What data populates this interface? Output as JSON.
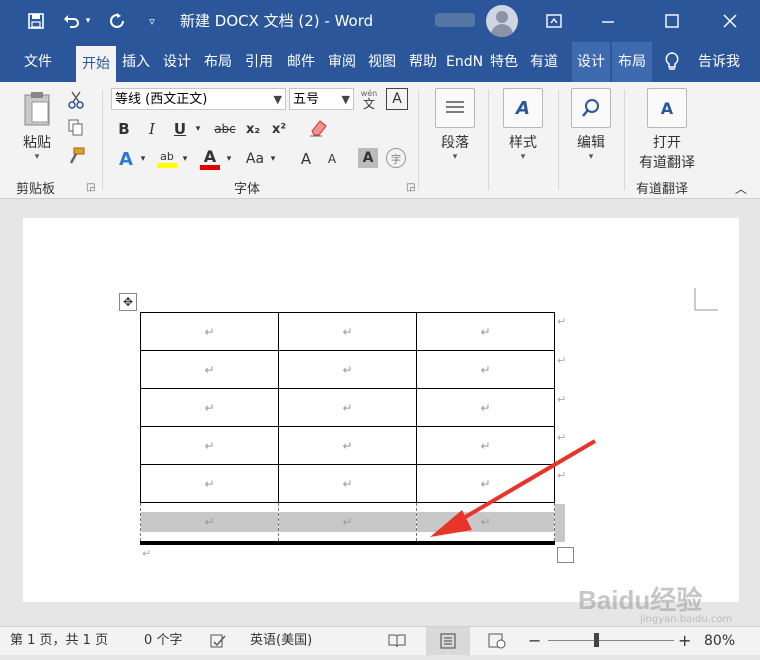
{
  "window": {
    "title": "新建 DOCX 文档 (2)  -  Word"
  },
  "quick_access": {
    "save_icon": "save-icon",
    "undo_icon": "undo-icon",
    "redo_icon": "redo-icon"
  },
  "tabs": [
    "文件",
    "开始",
    "插入",
    "设计",
    "布局",
    "引用",
    "邮件",
    "审阅",
    "视图",
    "帮助",
    "EndN",
    "特色",
    "有道",
    "设计",
    "布局"
  ],
  "tell_me": "告诉我",
  "ribbon": {
    "clipboard": {
      "paste": "粘贴",
      "label": "剪贴板"
    },
    "font": {
      "name": "等线 (西文正文)",
      "size": "五号",
      "label": "字体",
      "pinyin": "wén",
      "bold": "B",
      "italic": "I",
      "underline": "U",
      "strike": "abc",
      "subscript": "x₂",
      "superscript": "x²",
      "highlight_letters": "ab",
      "font_color_letter": "A",
      "change_case": "Aa",
      "grow": "A",
      "shrink": "A",
      "char_shading": "A",
      "enclose": "字",
      "clear_format": "◇"
    },
    "paragraph": {
      "label": "段落"
    },
    "styles": {
      "label": "样式"
    },
    "editing": {
      "label": "编辑"
    },
    "youdao": {
      "open_line1": "打开",
      "open_line2": "有道翻译",
      "label": "有道翻译"
    }
  },
  "document": {
    "cell_mark": "↵",
    "rows": 6,
    "cols": 3
  },
  "status": {
    "page": "第 1 页，共 1 页",
    "words": "0 个字",
    "language": "英语(美国)",
    "zoom": "80%"
  },
  "watermark": {
    "brand": "Baidu经验",
    "url": "jingyan.baidu.com"
  },
  "colors": {
    "accent": "#2b579a",
    "highlight": "#ffff00",
    "font_color": "#e00000",
    "shade": "#c8c8c8",
    "arrow": "#e8342b"
  }
}
